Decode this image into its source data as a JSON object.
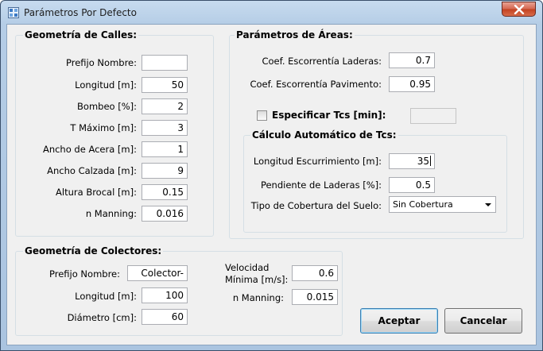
{
  "window": {
    "title": "Parámetros Por Defecto",
    "close_icon": "close-icon"
  },
  "calles": {
    "title": "Geometría de Calles:",
    "fields": [
      {
        "label": "Prefijo Nombre:",
        "value": ""
      },
      {
        "label": "Longitud [m]:",
        "value": "50"
      },
      {
        "label": "Bombeo [%]:",
        "value": "2"
      },
      {
        "label": "T Máximo [m]:",
        "value": "3"
      },
      {
        "label": "Ancho de Acera [m]:",
        "value": "1"
      },
      {
        "label": "Ancho Calzada [m]:",
        "value": "9"
      },
      {
        "label": "Altura Brocal [m]:",
        "value": "0.15"
      },
      {
        "label": "n Manning:",
        "value": "0.016"
      }
    ]
  },
  "areas": {
    "title": "Parámetros de Áreas:",
    "coef_laderas": {
      "label": "Coef. Escorrentía Laderas:",
      "value": "0.7"
    },
    "coef_pavimento": {
      "label": "Coef. Escorrentía Pavimento:",
      "value": "0.95"
    },
    "especificar_tcs": {
      "label": "Especificar Tcs [min]:",
      "checked": false,
      "value": ""
    },
    "calculo": {
      "title": "Cálculo Automático de Tcs:",
      "longitud": {
        "label": "Longitud Escurrimiento [m]:",
        "value": "35"
      },
      "pendiente": {
        "label": "Pendiente de Laderas [%]:",
        "value": "0.5"
      },
      "cobertura": {
        "label": "Tipo de Cobertura del Suelo:",
        "selected": "Sin Cobertura"
      }
    }
  },
  "colectores": {
    "title": "Geometría de Colectores:",
    "prefijo": {
      "label": "Prefijo Nombre:",
      "value": "Colector-"
    },
    "longitud": {
      "label": "Longitud [m]:",
      "value": "100"
    },
    "diametro": {
      "label": "Diámetro [cm]:",
      "value": "60"
    },
    "velocidad_line1": "Velocidad",
    "velocidad_line2": "Mínima [m/s]:",
    "velocidad_value": "0.6",
    "manning": {
      "label": "n Manning:",
      "value": "0.015"
    }
  },
  "buttons": {
    "aceptar": "Aceptar",
    "cancelar": "Cancelar"
  },
  "colors": {
    "accent_border": "#3c7fb1",
    "frame": "#b5cde6",
    "client": "#f0f0f0"
  }
}
